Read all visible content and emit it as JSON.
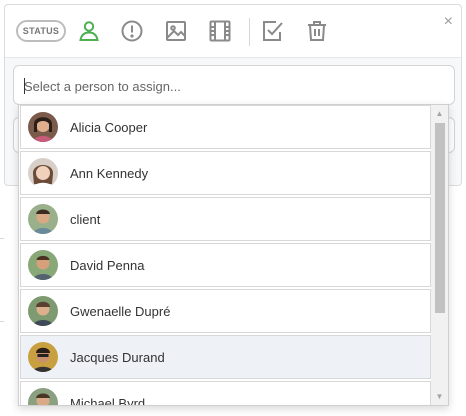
{
  "toolbar": {
    "status_label": "STATUS",
    "tools": [
      {
        "icon": "person-icon",
        "color": "#4caf50"
      },
      {
        "icon": "alert-circle-icon",
        "color": "#8a8a8a"
      },
      {
        "icon": "image-icon",
        "color": "#8a8a8a"
      },
      {
        "icon": "film-icon",
        "color": "#8a8a8a"
      },
      {
        "icon": "checkbox-icon",
        "color": "#8a8a8a"
      },
      {
        "icon": "trash-icon",
        "color": "#8a8a8a"
      }
    ],
    "close_label": "×"
  },
  "assign": {
    "placeholder": "Select a person to assign..."
  },
  "people": [
    {
      "name": "Alicia Cooper",
      "highlighted": false
    },
    {
      "name": "Ann Kennedy",
      "highlighted": false
    },
    {
      "name": "client",
      "highlighted": false
    },
    {
      "name": "David Penna",
      "highlighted": false
    },
    {
      "name": "Gwenaelle Dupré",
      "highlighted": false
    },
    {
      "name": "Jacques Durand",
      "highlighted": true
    },
    {
      "name": "Michael Byrd",
      "highlighted": false
    }
  ],
  "scrollbar": {
    "up_glyph": "▲",
    "down_glyph": "▼"
  }
}
